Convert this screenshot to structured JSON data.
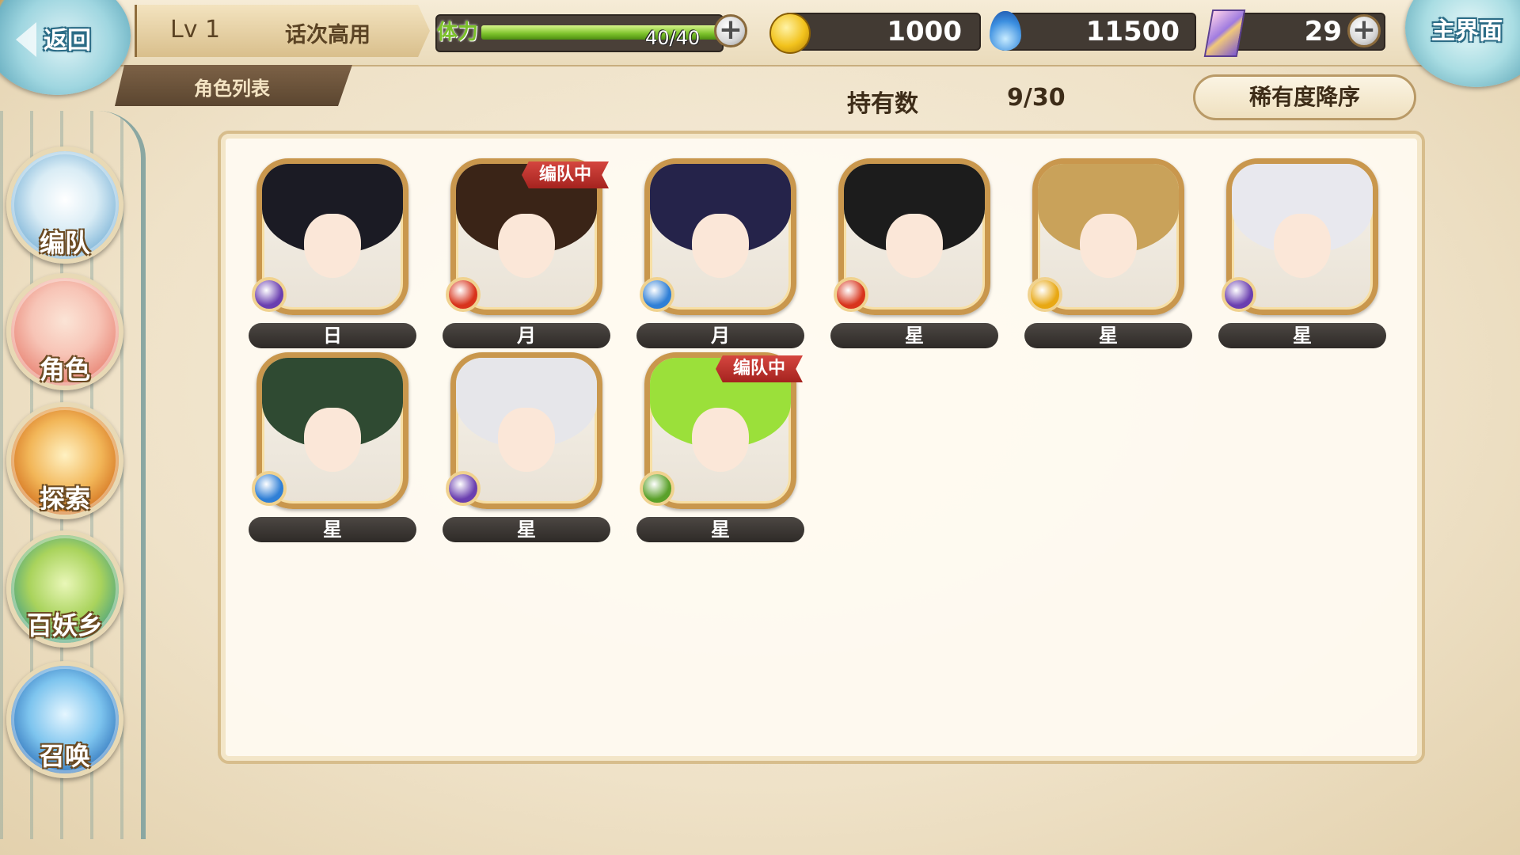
{
  "header": {
    "back_label": "返回",
    "level": "Lv 1",
    "title": "话次高用",
    "stamina_label": "体力",
    "stamina_value": "40/40",
    "stamina_fraction": 1.0,
    "coins": "1000",
    "spirit": "11500",
    "gems": "29",
    "home_label": "主界面"
  },
  "subheader": {
    "tab_label": "角色列表",
    "owned_label": "持有数",
    "owned_value": "9/30",
    "sort_label": "稀有度降序"
  },
  "nav": [
    {
      "label": "编队",
      "icon": "team-icon"
    },
    {
      "label": "角色",
      "icon": "character-icon"
    },
    {
      "label": "探索",
      "icon": "explore-icon"
    },
    {
      "label": "百妖乡",
      "icon": "village-icon"
    },
    {
      "label": "召唤",
      "icon": "summon-icon"
    }
  ],
  "team_badge_text": "编队中",
  "characters": [
    {
      "rank": "日",
      "element": "dark",
      "in_team": false,
      "hair": "#1b1b24"
    },
    {
      "rank": "月",
      "element": "fire",
      "in_team": true,
      "hair": "#3a2417"
    },
    {
      "rank": "月",
      "element": "water",
      "in_team": false,
      "hair": "#25234a"
    },
    {
      "rank": "星",
      "element": "fire",
      "in_team": false,
      "hair": "#1c1c1c"
    },
    {
      "rank": "星",
      "element": "light",
      "in_team": false,
      "hair": "#c9a25a"
    },
    {
      "rank": "星",
      "element": "dark",
      "in_team": false,
      "hair": "#e8e8ee"
    },
    {
      "rank": "星",
      "element": "water",
      "in_team": false,
      "hair": "#2f4a32"
    },
    {
      "rank": "星",
      "element": "dark",
      "in_team": false,
      "hair": "#e6e6ea"
    },
    {
      "rank": "星",
      "element": "wind",
      "in_team": true,
      "hair": "#9be03a"
    }
  ],
  "colors": {
    "fire": "#d8341c",
    "water": "#2f7fd6",
    "dark": "#6a3fb0",
    "light": "#e8a814",
    "wind": "#5aa12a"
  }
}
